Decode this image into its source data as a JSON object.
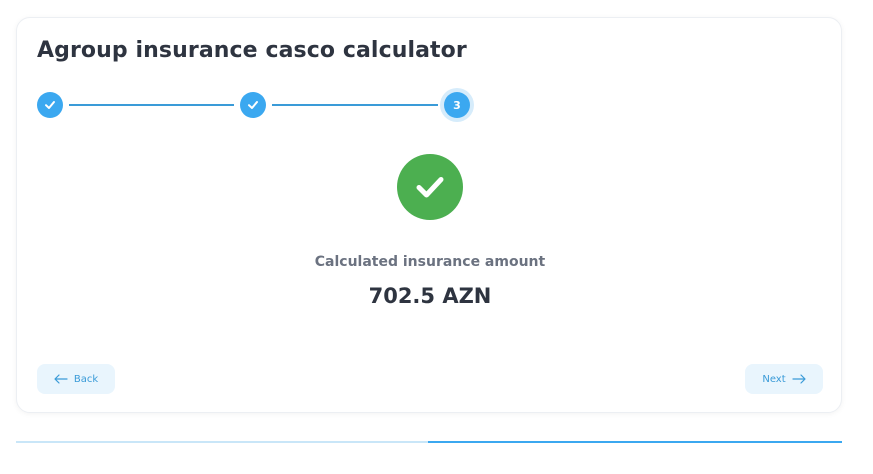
{
  "page": {
    "title": "Agroup insurance casco calculator"
  },
  "stepper": {
    "steps": [
      {
        "state": "completed",
        "icon": "check-icon"
      },
      {
        "state": "completed",
        "icon": "check-icon"
      },
      {
        "state": "current",
        "label": "3"
      }
    ]
  },
  "result": {
    "icon": "success-check-icon",
    "label": "Calculated insurance amount",
    "amount": "702.5 AZN"
  },
  "navigation": {
    "back_label": "Back",
    "next_label": "Next"
  },
  "colors": {
    "accent": "#3ba8f0",
    "success": "#4caf50",
    "button_bg": "#e9f5fd"
  }
}
